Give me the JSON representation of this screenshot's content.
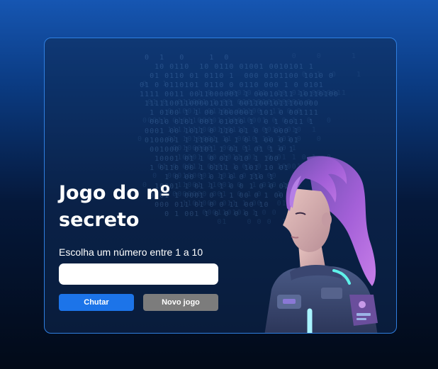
{
  "game": {
    "title": "Jogo do nº secreto",
    "prompt": "Escolha um número entre 1 a 10",
    "input_value": "",
    "guess_button": "Chutar",
    "new_game_button": "Novo jogo"
  },
  "illustration": {
    "icon": "robot-girl-illustration"
  },
  "colors": {
    "primary_button": "#1c74e9",
    "secondary_button": "#7c7c7c",
    "container_border": "#2f7fe0"
  }
}
